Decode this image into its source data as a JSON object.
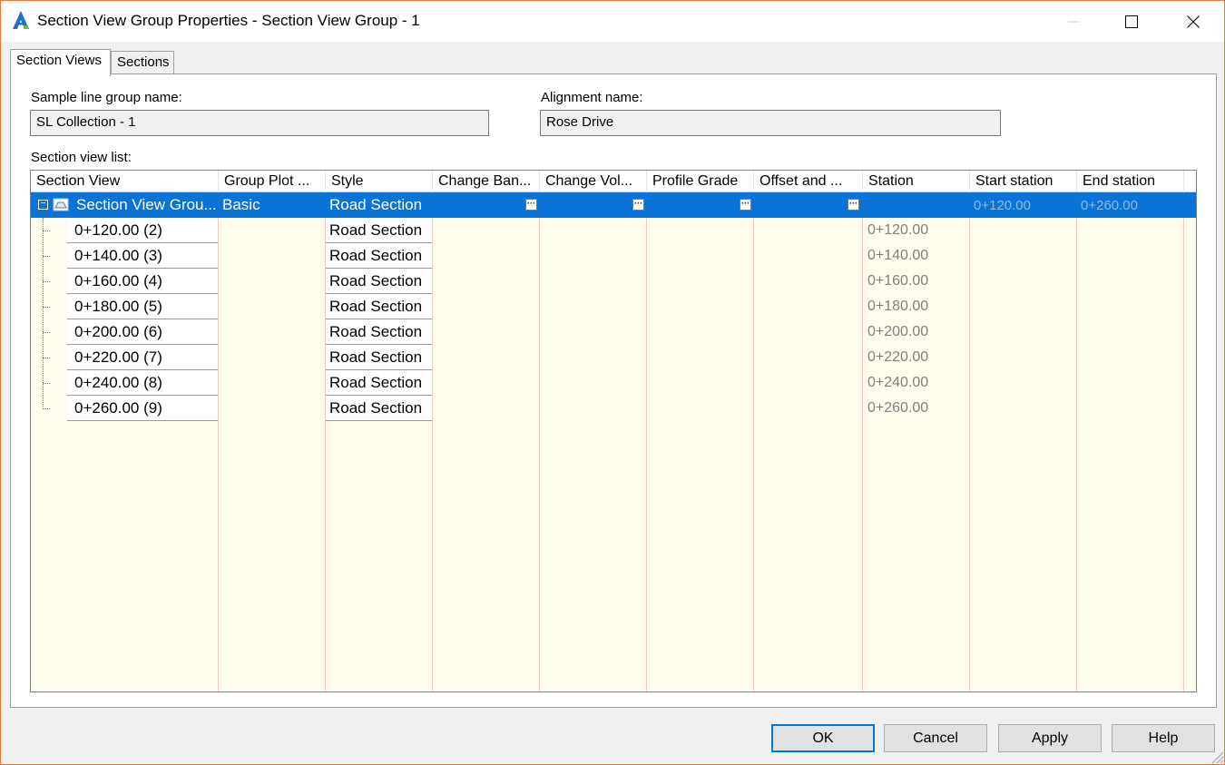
{
  "window": {
    "title": "Section View Group Properties - Section View Group - 1",
    "accent_border": "#e07b39"
  },
  "tabs": [
    {
      "label": "Section Views",
      "active": true
    },
    {
      "label": "Sections",
      "active": false
    }
  ],
  "form": {
    "sample_line_group_label": "Sample line group name:",
    "sample_line_group_value": "SL Collection - 1",
    "alignment_label": "Alignment name:",
    "alignment_value": "Rose Drive",
    "list_label": "Section view list:"
  },
  "grid": {
    "columns": [
      "Section View",
      "Group Plot ...",
      "Style",
      "Change Ban...",
      "Change Vol...",
      "Profile Grade",
      "Offset and ...",
      "Station",
      "Start station",
      "End station"
    ],
    "group_row": {
      "section_view": "Section View Grou...",
      "group_plot": "Basic",
      "style": "Road Section",
      "start_station": "0+120.00",
      "end_station": "0+260.00",
      "selected_color": "#0a74d6"
    },
    "rows": [
      {
        "section_view": "0+120.00 (2)",
        "style": "Road Section",
        "station": "0+120.00"
      },
      {
        "section_view": "0+140.00 (3)",
        "style": "Road Section",
        "station": "0+140.00"
      },
      {
        "section_view": "0+160.00 (4)",
        "style": "Road Section",
        "station": "0+160.00"
      },
      {
        "section_view": "0+180.00 (5)",
        "style": "Road Section",
        "station": "0+180.00"
      },
      {
        "section_view": "0+200.00 (6)",
        "style": "Road Section",
        "station": "0+200.00"
      },
      {
        "section_view": "0+220.00 (7)",
        "style": "Road Section",
        "station": "0+220.00"
      },
      {
        "section_view": "0+240.00 (8)",
        "style": "Road Section",
        "station": "0+240.00"
      },
      {
        "section_view": "0+260.00 (9)",
        "style": "Road Section",
        "station": "0+260.00"
      }
    ]
  },
  "buttons": {
    "ok": "OK",
    "cancel": "Cancel",
    "apply": "Apply",
    "help": "Help"
  },
  "icons": {
    "app": "autocad-civil-icon",
    "tree_node": "section-view-group-icon",
    "ellipsis": "ellipsis-button-icon"
  }
}
